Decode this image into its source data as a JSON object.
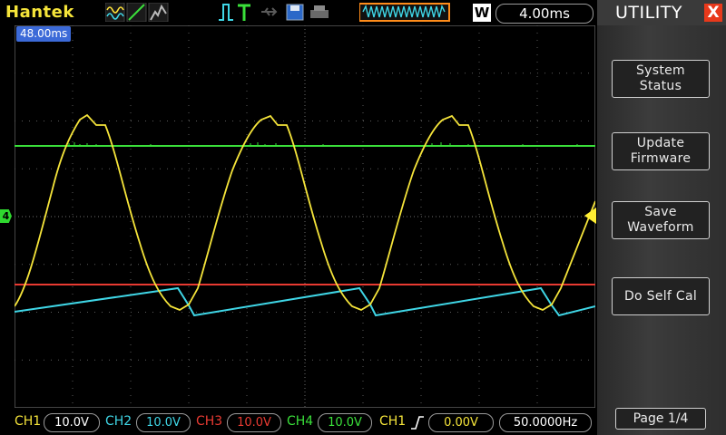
{
  "header": {
    "brand": "Hantek",
    "timebase_mode": "W",
    "timebase": "4.00ms"
  },
  "screen": {
    "trigger_position": "48.00ms",
    "ch4_marker": "4"
  },
  "channels": [
    {
      "label": "CH1",
      "volts": "10.0V",
      "color": "#f5e43a"
    },
    {
      "label": "CH2",
      "volts": "10.0V",
      "color": "#3fd6e6"
    },
    {
      "label": "CH3",
      "volts": "10.0V",
      "color": "#e83a32"
    },
    {
      "label": "CH4",
      "volts": "10.0V",
      "color": "#3ae03a"
    }
  ],
  "trigger": {
    "source": "CH1",
    "level": "0.00V",
    "frequency": "50.0000Hz"
  },
  "menu": {
    "title": "UTILITY",
    "close": "X",
    "buttons": [
      {
        "label": "System\nStatus"
      },
      {
        "label": "Update\nFirmware"
      },
      {
        "label": "Save\nWaveform"
      },
      {
        "label": "Do Self Cal"
      }
    ],
    "page": "Page 1/4"
  },
  "colors": {
    "ch1": "#f5e43a",
    "ch2": "#3fd6e6",
    "ch3": "#e83a32",
    "ch4": "#3ae03a",
    "grid": "#5a5a5a",
    "accent": "#3c6ad8",
    "close": "#e8391b"
  }
}
